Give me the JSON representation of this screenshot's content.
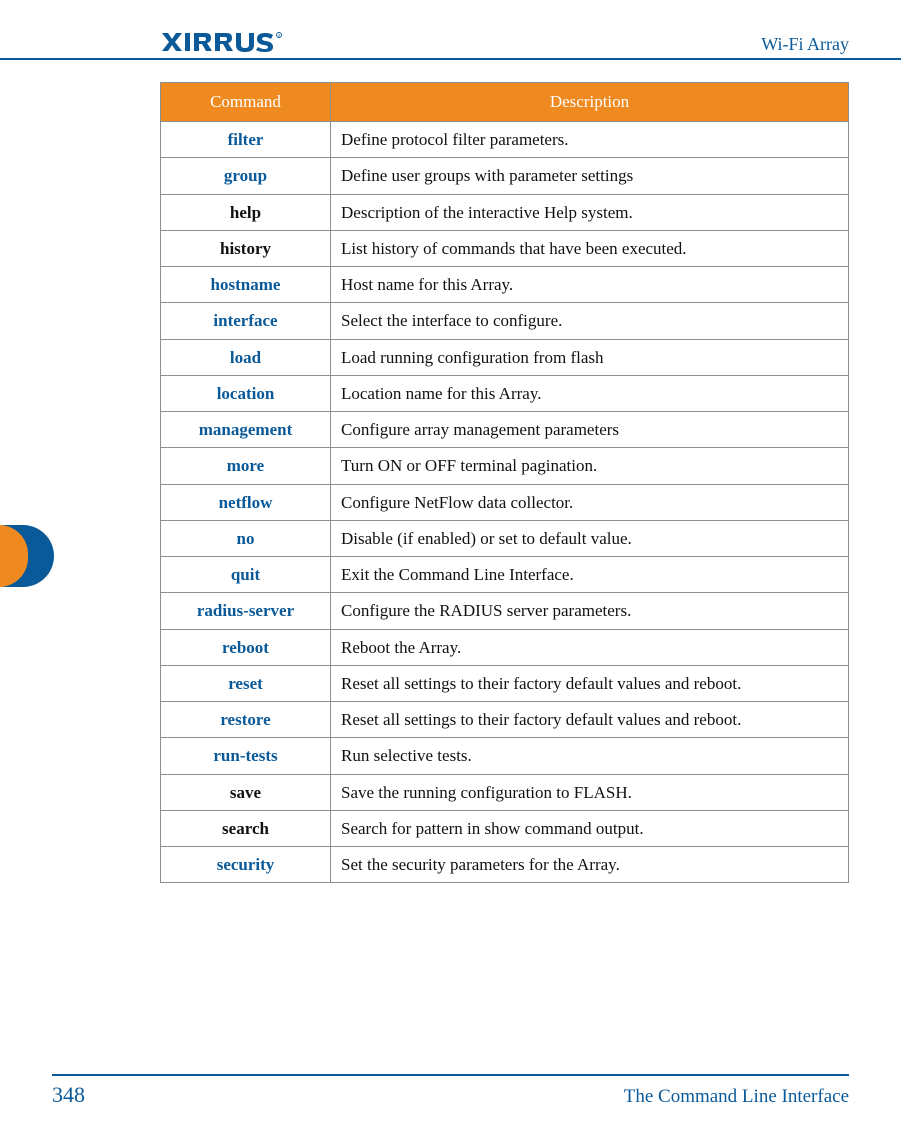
{
  "header": {
    "brand": "XIRRUS",
    "right": "Wi-Fi Array"
  },
  "table": {
    "headers": {
      "command": "Command",
      "description": "Description"
    },
    "rows": [
      {
        "command": "filter",
        "link": true,
        "description": "Define protocol filter parameters."
      },
      {
        "command": "group",
        "link": true,
        "description": "Define user groups with parameter settings"
      },
      {
        "command": "help",
        "link": false,
        "description": "Description of the interactive Help system."
      },
      {
        "command": "history",
        "link": false,
        "description": "List history of commands that have been executed."
      },
      {
        "command": "hostname",
        "link": true,
        "description": "Host name for this Array."
      },
      {
        "command": "interface",
        "link": true,
        "description": "Select the interface to configure."
      },
      {
        "command": "load",
        "link": true,
        "description": "Load running configuration from flash"
      },
      {
        "command": "location",
        "link": true,
        "description": "Location name for this Array."
      },
      {
        "command": "management",
        "link": true,
        "description": "Configure array management parameters"
      },
      {
        "command": "more",
        "link": true,
        "description": "Turn ON or OFF terminal pagination."
      },
      {
        "command": "netflow",
        "link": true,
        "description": "Configure NetFlow data collector."
      },
      {
        "command": "no",
        "link": true,
        "description": "Disable (if enabled) or set to default value."
      },
      {
        "command": "quit",
        "link": true,
        "description": "Exit the Command Line Interface."
      },
      {
        "command": "radius-server",
        "link": true,
        "description": "Configure the RADIUS server parameters."
      },
      {
        "command": "reboot",
        "link": true,
        "description": "Reboot the Array."
      },
      {
        "command": "reset",
        "link": true,
        "description": "Reset all settings to their factory default values and reboot."
      },
      {
        "command": "restore",
        "link": true,
        "description": "Reset all settings to their factory default values and reboot."
      },
      {
        "command": "run-tests",
        "link": true,
        "description": "Run selective tests."
      },
      {
        "command": "save",
        "link": false,
        "description": "Save the running configuration to FLASH."
      },
      {
        "command": "search",
        "link": false,
        "description": "Search for pattern in show command output."
      },
      {
        "command": "security",
        "link": true,
        "description": "Set the security parameters for the Array."
      }
    ]
  },
  "footer": {
    "page": "348",
    "title": "The Command Line Interface"
  }
}
